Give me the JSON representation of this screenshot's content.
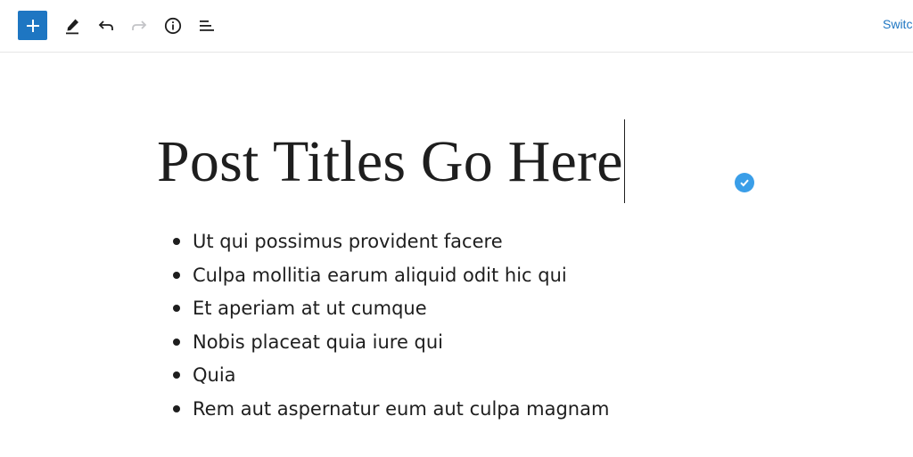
{
  "toolbar": {
    "add_block_icon": "plus-icon",
    "tools_icon": "pencil-icon",
    "undo_icon": "undo-icon",
    "redo_icon": "redo-icon",
    "details_icon": "info-icon",
    "list_view_icon": "list-view-icon",
    "switch_label": "Switch",
    "colors": {
      "accent": "#1e76c2",
      "redo_disabled": "#c3c4c7",
      "text": "#1e1e1e"
    }
  },
  "editor": {
    "title": "Post Titles Go Here",
    "status_icon": "check-circle-icon",
    "status_color": "#3a9ee8",
    "list_items": [
      "Ut qui possimus provident facere",
      "Culpa mollitia earum aliquid odit hic qui",
      "Et aperiam at ut cumque",
      "Nobis placeat quia iure qui",
      "Quia",
      "Rem aut aspernatur eum aut culpa magnam"
    ]
  }
}
